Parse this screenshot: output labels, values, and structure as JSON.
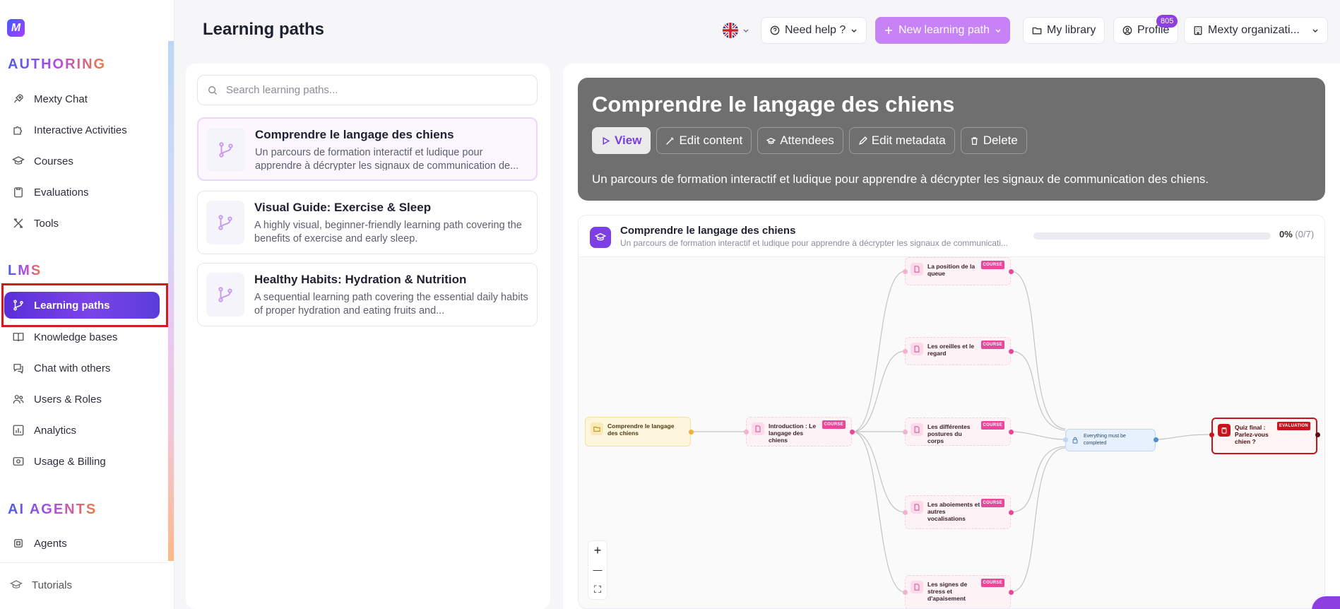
{
  "sidebar": {
    "logo_letter": "M",
    "sections": [
      {
        "title": "AUTHORING"
      },
      {
        "title": "LMS"
      },
      {
        "title": "AI AGENTS"
      }
    ],
    "authoring_items": [
      {
        "label": "Mexty Chat",
        "icon": "rocket-icon"
      },
      {
        "label": "Interactive Activities",
        "icon": "puzzle-icon"
      },
      {
        "label": "Courses",
        "icon": "graduation-cap-icon"
      },
      {
        "label": "Evaluations",
        "icon": "clipboard-icon"
      },
      {
        "label": "Tools",
        "icon": "tools-icon"
      }
    ],
    "lms_items": [
      {
        "label": "Learning paths",
        "icon": "git-branch-icon",
        "active": true
      },
      {
        "label": "Knowledge bases",
        "icon": "book-icon"
      },
      {
        "label": "Chat with others",
        "icon": "chat-icon"
      },
      {
        "label": "Users & Roles",
        "icon": "users-icon"
      },
      {
        "label": "Analytics",
        "icon": "chart-icon"
      },
      {
        "label": "Usage & Billing",
        "icon": "billing-icon"
      }
    ],
    "agent_items": [
      {
        "label": "Agents",
        "icon": "cpu-icon"
      }
    ],
    "footer_items": [
      {
        "label": "Tutorials",
        "icon": "graduation-cap-icon"
      }
    ]
  },
  "header": {
    "title": "Learning paths",
    "language": "en-GB",
    "help_label": "Need help ?",
    "new_path_label": "New learning path",
    "library_label": "My library",
    "profile_label": "Profile",
    "profile_badge": "805",
    "org_label": "Mexty organizati..."
  },
  "list": {
    "search_placeholder": "Search learning paths...",
    "search_value": "",
    "items": [
      {
        "title": "Comprendre le langage des chiens",
        "description": "Un parcours de formation interactif et ludique pour apprendre à décrypter les signaux de communication de...",
        "selected": true
      },
      {
        "title": "Visual Guide: Exercise & Sleep",
        "description": "A highly visual, beginner-friendly learning path covering the benefits of exercise and early sleep."
      },
      {
        "title": "Healthy Habits: Hydration & Nutrition",
        "description": "A sequential learning path covering the essential daily habits of proper hydration and eating fruits and..."
      }
    ]
  },
  "detail": {
    "title": "Comprendre le langage des chiens",
    "actions": {
      "view": "View",
      "edit_content": "Edit content",
      "attendees": "Attendees",
      "edit_metadata": "Edit metadata",
      "delete": "Delete"
    },
    "description": "Un parcours de formation interactif et ludique pour apprendre à décrypter les signaux de communication des chiens.",
    "flow": {
      "title": "Comprendre le langage des chiens",
      "subtitle": "Un parcours de formation interactif et ludique pour apprendre à décrypter les signaux de communicati...",
      "progress_fraction": 0,
      "progress_percent": "0%",
      "progress_count": "(0/7)",
      "nodes": {
        "start": "Comprendre le langage des chiens",
        "intro": "Introduction : Le langage des chiens",
        "queue": "La position de la queue",
        "ears": "Les oreilles et le regard",
        "postures": "Les différentes postures du corps",
        "barks": "Les aboiements et autres vocalisations",
        "stress": "Les signes de stress et d'apaisement",
        "gate": "Everything must be completed",
        "final": "Quiz final : Parlez-vous chien ?"
      },
      "tags": {
        "course": "COURSE",
        "evaluation": "EVALUATION"
      },
      "zoom": {
        "in": "+",
        "out": "—",
        "fit": "⛶"
      }
    }
  },
  "colors": {
    "accent": "#7b3fe4",
    "primary_button": "#c783f6",
    "hero_bg": "#6f6f6f",
    "course_tag": "#e8479a",
    "evaluation_tag": "#c8141c",
    "highlight_box": "#d11c1c"
  }
}
